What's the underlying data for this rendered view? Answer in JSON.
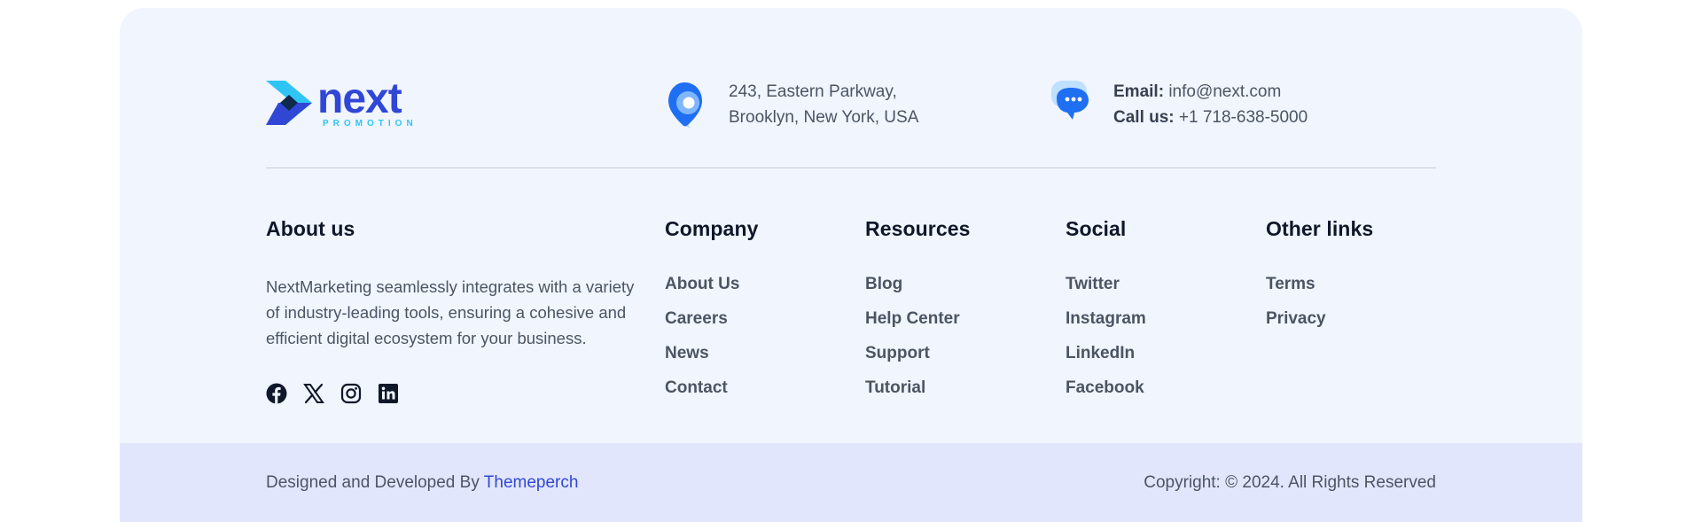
{
  "brand": {
    "name": "next",
    "tagline": "PROMOTION",
    "colors": {
      "primary": "#3047d6",
      "accent": "#2ec5f5",
      "dark": "#0f2a4a"
    }
  },
  "contact": {
    "address_line1": "243, Eastern Parkway,",
    "address_line2": "Brooklyn, New York, USA",
    "email_label": "Email:",
    "email_value": "info@next.com",
    "phone_label": "Call us:",
    "phone_value": "+1 718-638-5000",
    "icons": [
      "location-pin-icon",
      "chat-bubble-icon"
    ]
  },
  "about": {
    "title": "About us",
    "text": "NextMarketing seamlessly integrates with a variety of industry-leading tools, ensuring a cohesive and efficient digital ecosystem for your business.",
    "social_icons": [
      "facebook-icon",
      "x-twitter-icon",
      "instagram-icon",
      "linkedin-icon"
    ]
  },
  "columns": {
    "company": {
      "title": "Company",
      "links": [
        "About Us",
        "Careers",
        "News",
        "Contact"
      ]
    },
    "resources": {
      "title": "Resources",
      "links": [
        "Blog",
        "Help Center",
        "Support",
        "Tutorial"
      ]
    },
    "social": {
      "title": "Social",
      "links": [
        "Twitter",
        "Instagram",
        "LinkedIn",
        "Facebook"
      ]
    },
    "other": {
      "title": "Other links",
      "links": [
        "Terms",
        "Privacy"
      ]
    }
  },
  "bottom": {
    "credit_prefix": "Designed and Developed By",
    "credit_link": "Themeperch",
    "copyright": "Copyright: © 2024. All Rights Reserved"
  }
}
